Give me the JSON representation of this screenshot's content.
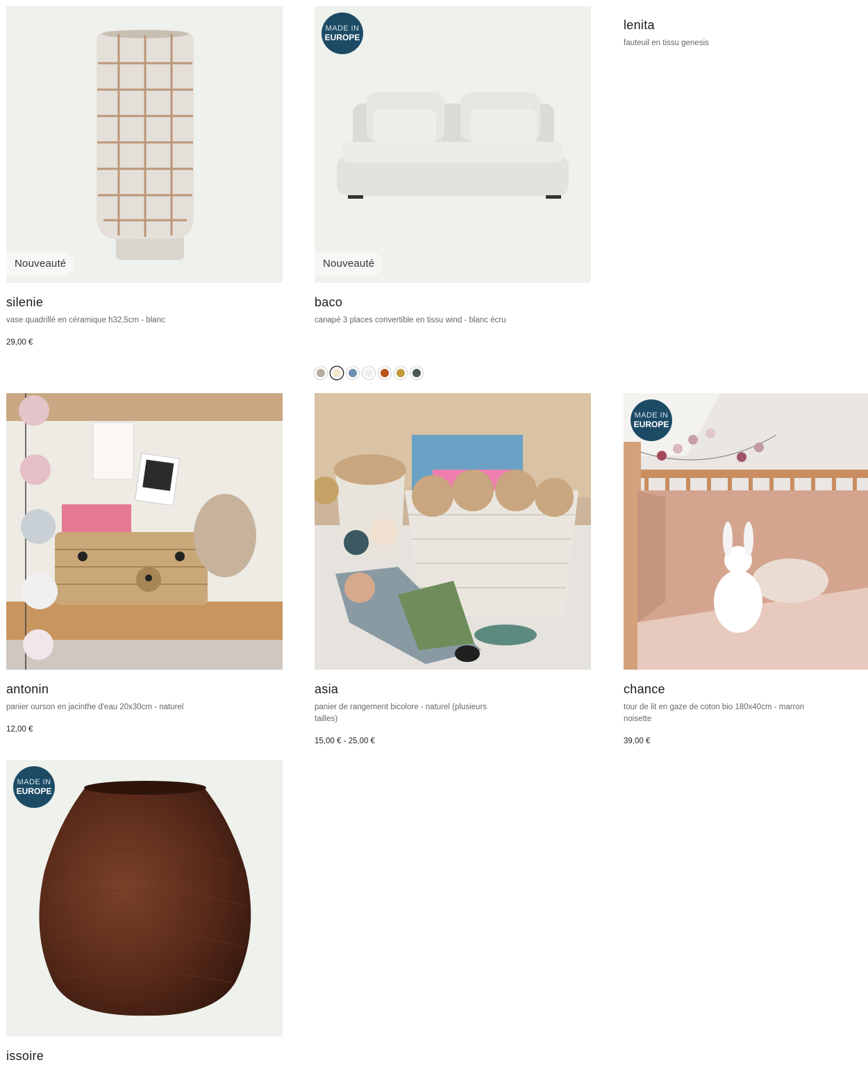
{
  "products": [
    {
      "name": "silenie",
      "desc": "vase quadrillé en céramique h32,5cm - blanc",
      "price": "29,00 €",
      "badge": "Nouveauté"
    },
    {
      "name": "baco",
      "desc": "canapé 3 places convertible en tissu wind - blanc écru",
      "badge": "Nouveauté",
      "eu_badge": {
        "line1": "MADE IN",
        "line2": "EUROPE"
      },
      "swatches": [
        "#b8ada0",
        "#f3e8cd",
        "#6e8fb0",
        "#eeeff1",
        "#b5561c",
        "#c19a3c",
        "#4d5650"
      ]
    },
    {
      "name": "lenita",
      "desc": "fauteuil en tissu genesis"
    },
    {
      "name": "antonin",
      "desc": "panier ourson en jacinthe d'eau 20x30cm - naturel",
      "price": "12,00 €"
    },
    {
      "name": "asia",
      "desc": "panier de rangement bicolore - naturel (plusieurs tailles)",
      "price": "15,00 € - 25,00 €"
    },
    {
      "name": "chance",
      "desc": "tour de lit en gaze de coton bio 180x40cm - marron noisette",
      "price": "39,00 €",
      "eu_badge": {
        "line1": "MADE IN",
        "line2": "EUROPE"
      }
    },
    {
      "name": "issoire",
      "eu_badge": {
        "line1": "MADE IN",
        "line2": "EUROPE"
      }
    }
  ]
}
